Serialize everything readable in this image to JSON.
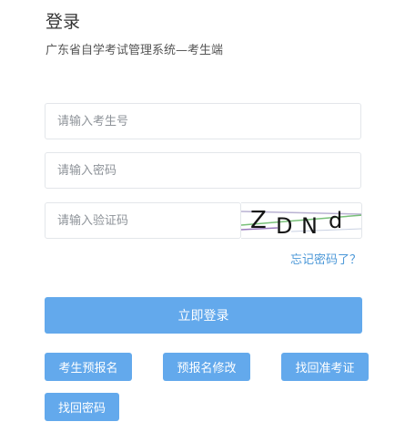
{
  "header": {
    "title": "登录",
    "subtitle": "广东省自学考试管理系统—考生端"
  },
  "form": {
    "student_id_placeholder": "请输入考生号",
    "password_placeholder": "请输入密码",
    "captcha_placeholder": "请输入验证码",
    "captcha_text": "ZDNd",
    "forgot_password_label": "忘记密码了？",
    "login_label": "立即登录"
  },
  "actions": {
    "pre_register_label": "考生预报名",
    "modify_pre_register_label": "预报名修改",
    "retrieve_admission_label": "找回准考证",
    "retrieve_password_label": "找回密码"
  },
  "colors": {
    "primary": "#63a9ec",
    "link": "#4c98d8",
    "border": "#e3e6ea",
    "placeholder": "#8e9399"
  }
}
